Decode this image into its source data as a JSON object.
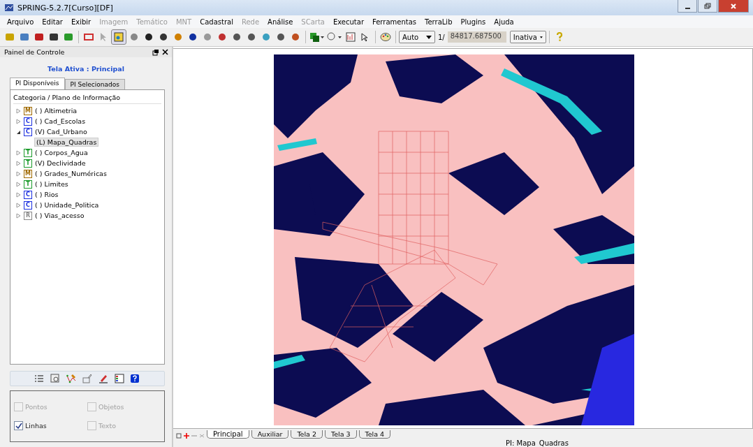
{
  "window": {
    "title": "SPRING-5.2.7[Curso][DF]"
  },
  "menu": [
    {
      "label": "Arquivo",
      "disabled": false
    },
    {
      "label": "Editar",
      "disabled": false
    },
    {
      "label": "Exibir",
      "disabled": false
    },
    {
      "label": "Imagem",
      "disabled": true
    },
    {
      "label": "Temático",
      "disabled": true
    },
    {
      "label": "MNT",
      "disabled": true
    },
    {
      "label": "Cadastral",
      "disabled": false
    },
    {
      "label": "Rede",
      "disabled": true
    },
    {
      "label": "Análise",
      "disabled": false
    },
    {
      "label": "SCarta",
      "disabled": true
    },
    {
      "label": "Executar",
      "disabled": false
    },
    {
      "label": "Ferramentas",
      "disabled": false
    },
    {
      "label": "TerraLib",
      "disabled": false
    },
    {
      "label": "Plugins",
      "disabled": false
    },
    {
      "label": "Ajuda",
      "disabled": false
    }
  ],
  "toolbar": {
    "scale_mode": "Auto",
    "scale_prefix": "1/",
    "scale_value": "84817.687500",
    "mode": "Inativa"
  },
  "panel": {
    "title": "Painel de Controle",
    "active_screen": "Tela Ativa : Principal",
    "tabs": [
      {
        "label": "PI Disponíveis",
        "selected": true
      },
      {
        "label": "PI Selecionados",
        "selected": false
      }
    ],
    "tree_header": "Categoria / Plano de Informação",
    "tree": [
      {
        "badge": "M",
        "kind": "mnt",
        "label": "( ) Altimetria",
        "expanded": false
      },
      {
        "badge": "C",
        "kind": "cadastral",
        "label": "( ) Cad_Escolas",
        "expanded": false
      },
      {
        "badge": "C",
        "kind": "cadastral",
        "label": "(V) Cad_Urbano",
        "expanded": true,
        "children": [
          {
            "label": "(L) Mapa_Quadras",
            "selected": true
          }
        ]
      },
      {
        "badge": "T",
        "kind": "tematico",
        "label": "( ) Corpos_Agua",
        "expanded": false
      },
      {
        "badge": "T",
        "kind": "tematico",
        "label": "(V) Declividade",
        "expanded": false
      },
      {
        "badge": "M",
        "kind": "mnt",
        "label": "( ) Grades_Numéricas",
        "expanded": false
      },
      {
        "badge": "T",
        "kind": "tematico",
        "label": "( ) Limites",
        "expanded": false
      },
      {
        "badge": "C",
        "kind": "cadastral",
        "label": "( ) Rios",
        "expanded": false
      },
      {
        "badge": "C",
        "kind": "cadastral",
        "label": "( ) Unidade_Politica",
        "expanded": false
      },
      {
        "badge": "R",
        "kind": "rede",
        "label": "( ) Vias_acesso",
        "expanded": false
      }
    ],
    "options": [
      {
        "label": "Pontos",
        "checked": false,
        "disabled": true
      },
      {
        "label": "Objetos",
        "checked": false,
        "disabled": true
      },
      {
        "label": "Linhas",
        "checked": true,
        "disabled": false
      },
      {
        "label": "Texto",
        "checked": false,
        "disabled": true
      }
    ]
  },
  "screen_tabs": [
    {
      "label": "Principal",
      "selected": true
    },
    {
      "label": "Auxiliar",
      "selected": false
    },
    {
      "label": "Tela 2",
      "selected": false
    },
    {
      "label": "Tela 3",
      "selected": false
    },
    {
      "label": "Tela 4",
      "selected": false
    }
  ],
  "status": "PI: Mapa_Quadras"
}
